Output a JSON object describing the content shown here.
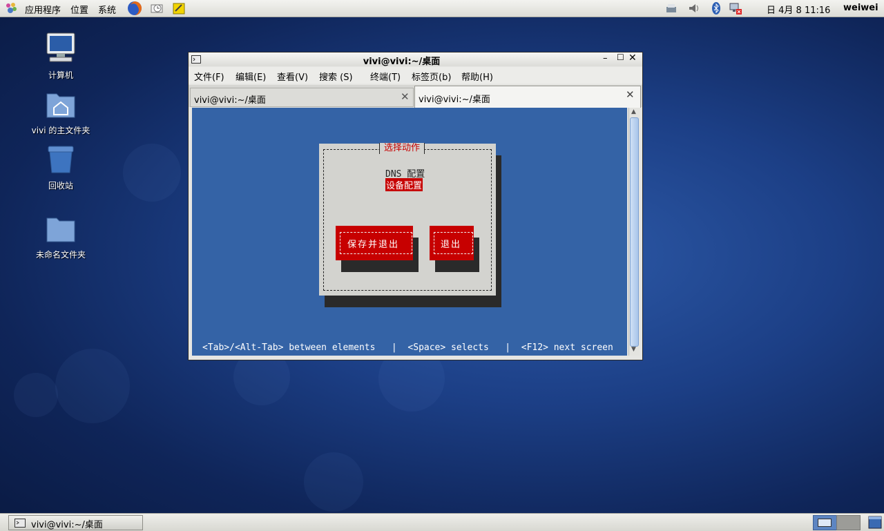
{
  "top_panel": {
    "menu_applications": "应用程序",
    "menu_places": "位置",
    "menu_system": "系统",
    "clock": "日 4月  8 11:16",
    "user": "weiwei"
  },
  "desktop": {
    "icons": [
      {
        "label": "计算机"
      },
      {
        "label": "vivi 的主文件夹"
      },
      {
        "label": "回收站"
      },
      {
        "label": "未命名文件夹"
      }
    ]
  },
  "window": {
    "title": "vivi@vivi:~/桌面",
    "menu": [
      "文件(F)",
      "编辑(E)",
      "查看(V)",
      "搜索 (S)",
      "终端(T)",
      "标签页(b)",
      "帮助(H)"
    ],
    "tabs": [
      {
        "label": "vivi@vivi:~/桌面",
        "active": false
      },
      {
        "label": "vivi@vivi:~/桌面",
        "active": true
      }
    ]
  },
  "terminal": {
    "dialog_title": "选择动作",
    "options": [
      "DNS 配置",
      "设备配置"
    ],
    "selected_option": "设备配置",
    "btn_save_quit": "保存并退出",
    "btn_quit": "退出",
    "status_line": "<Tab>/<Alt-Tab> between elements   |  <Space> selects   |  <F12> next screen"
  },
  "taskbar": {
    "task_label": "vivi@vivi:~/桌面"
  },
  "colors": {
    "terminal_bg": "#3463a6",
    "dialog_bg": "#d3d3cf",
    "accent_red": "#c70000",
    "shadow": "#2a2a2a"
  }
}
